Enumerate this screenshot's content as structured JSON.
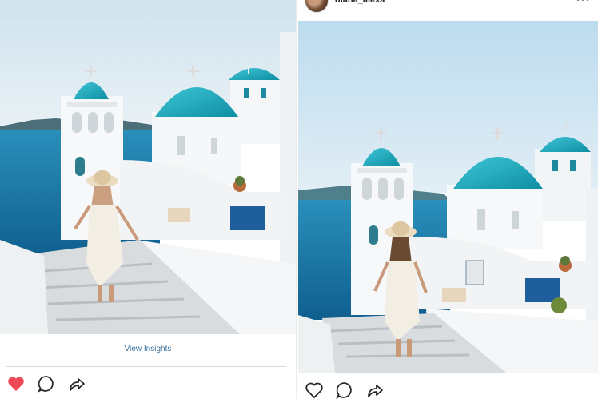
{
  "left_post": {
    "insights_label": "View Insights",
    "liked": true,
    "icons": [
      "heart-filled-icon",
      "comment-icon",
      "share-icon"
    ]
  },
  "right_post": {
    "username": "diana_alexa",
    "liked": false,
    "icons": [
      "heart-outline-icon",
      "comment-icon",
      "share-icon",
      "more-options-icon"
    ]
  },
  "colors": {
    "link": "#3f729b",
    "like_red": "#ed4956",
    "dome_turquoise": "#1fa6b8",
    "sea_blue": "#1c7fae"
  }
}
